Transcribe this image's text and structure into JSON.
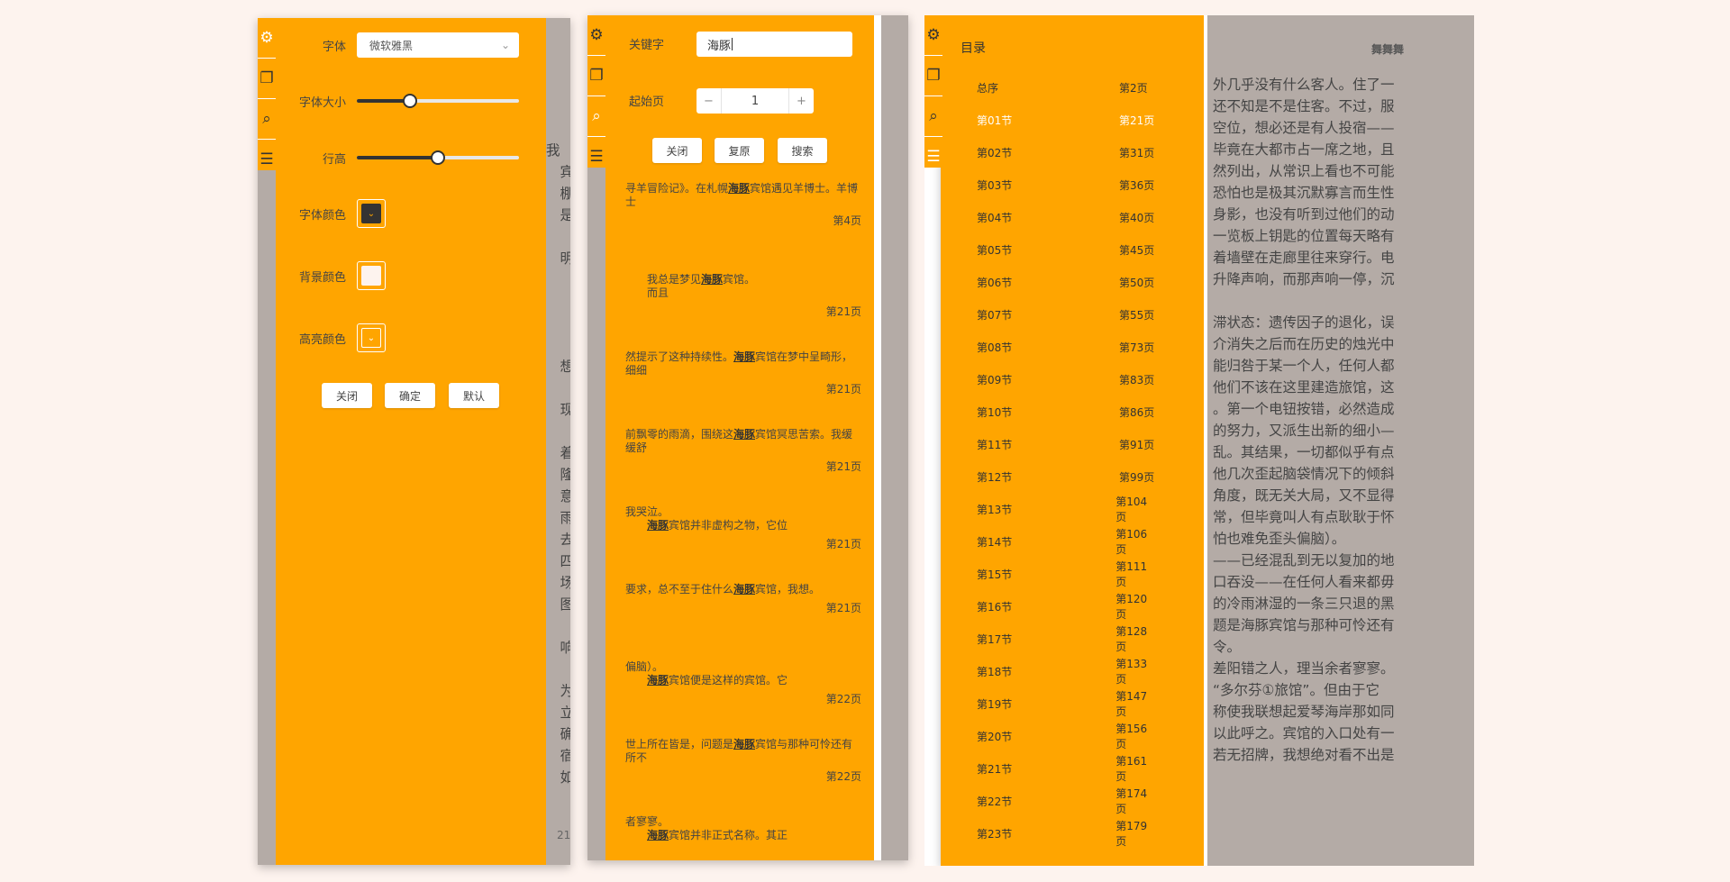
{
  "settings": {
    "font_label": "字体",
    "font_value": "微软雅黑",
    "font_size_label": "字体大小",
    "font_size_value": 0.33,
    "line_height_label": "行高",
    "line_height_value": 0.5,
    "font_color_label": "字体颜色",
    "font_color": "#333333",
    "bg_color_label": "背景颜色",
    "bg_color": "#fdf3ee",
    "highlight_color_label": "高亮颜色",
    "highlight_color": "#ffa500",
    "close_label": "关闭",
    "ok_label": "确定",
    "default_label": "默认"
  },
  "reader1": {
    "lines": "我\n　宾\n　棚\n　是在\n\n　明显\n\n\n\n\n　想。\n　　无\n　现\n　　然\n　着\n　隆\n　意\n　雨\n　去\n　四肢\n　场\n　图\n　　缓\n　响\n　　我\n　为\n　立于\n　确\n　宿\n　如",
    "page_no": "21"
  },
  "search": {
    "keyword_label": "关键字",
    "keyword_value": "海豚",
    "start_page_label": "起始页",
    "start_page_value": "1",
    "minus": "−",
    "plus": "+",
    "close_label": "关闭",
    "reset_label": "复原",
    "search_label": "搜索",
    "results": [
      {
        "before": "寻羊冒险记》。在札幌",
        "kw": "海豚",
        "after": "宾馆遇见羊博士。羊博士",
        "page": "第4页"
      },
      {
        "before": "　　我总是梦见",
        "kw": "海豚",
        "after": "宾馆。\n　　而且",
        "page": "第21页"
      },
      {
        "before": "然提示了这种持续性。",
        "kw": "海豚",
        "after": "宾馆在梦中呈畸形，细细",
        "page": "第21页"
      },
      {
        "before": "前飘零的雨滴，围绕这",
        "kw": "海豚",
        "after": "宾馆冥思苦索。我缓缓舒",
        "page": "第21页"
      },
      {
        "before": "我哭泣。\n　　",
        "kw": "海豚",
        "after": "宾馆并非虚构之物，它位",
        "page": "第21页"
      },
      {
        "before": "要求，总不至于住什么",
        "kw": "海豚",
        "after": "宾馆，我想。",
        "page": "第21页"
      },
      {
        "before": "偏脑）。\n　　",
        "kw": "海豚",
        "after": "宾馆便是这样的宾馆。它",
        "page": "第22页"
      },
      {
        "before": "世上所在皆是，问题是",
        "kw": "海豚",
        "after": "宾馆与那种可怜还有所不",
        "page": "第22页"
      },
      {
        "before": "者寥寥。\n　　",
        "kw": "海豚",
        "after": "宾馆并非正式名称。其正",
        "page": ""
      }
    ]
  },
  "toc": {
    "title": "目录",
    "items": [
      {
        "name": "总序",
        "page": "第2页"
      },
      {
        "name": "第01节",
        "page": "第21页"
      },
      {
        "name": "第02节",
        "page": "第31页"
      },
      {
        "name": "第03节",
        "page": "第36页"
      },
      {
        "name": "第04节",
        "page": "第40页"
      },
      {
        "name": "第05节",
        "page": "第45页"
      },
      {
        "name": "第06节",
        "page": "第50页"
      },
      {
        "name": "第07节",
        "page": "第55页"
      },
      {
        "name": "第08节",
        "page": "第73页"
      },
      {
        "name": "第09节",
        "page": "第83页"
      },
      {
        "name": "第10节",
        "page": "第86页"
      },
      {
        "name": "第11节",
        "page": "第91页"
      },
      {
        "name": "第12节",
        "page": "第99页"
      },
      {
        "name": "第13节",
        "page": "第104页"
      },
      {
        "name": "第14节",
        "page": "第106页"
      },
      {
        "name": "第15节",
        "page": "第111页"
      },
      {
        "name": "第16节",
        "page": "第120页"
      },
      {
        "name": "第17节",
        "page": "第128页"
      },
      {
        "name": "第18节",
        "page": "第133页"
      },
      {
        "name": "第19节",
        "page": "第147页"
      },
      {
        "name": "第20节",
        "page": "第156页"
      },
      {
        "name": "第21节",
        "page": "第161页"
      },
      {
        "name": "第22节",
        "page": "第174页"
      },
      {
        "name": "第23节",
        "page": "第179页"
      }
    ],
    "active_index": 1
  },
  "reader3": {
    "header": "舞舞舞",
    "lines": "外几乎没有什么客人。住了一\n还不知是不是住客。不过，服\n空位，想必还是有人投宿——\n毕竟在大都市占一席之地，且\n然列出，从常识上看也不可能\n恐怕也是极其沉默寡言而生性\n身影，也没有听到过他们的动\n一览板上钥匙的位置每天略有\n着墙壁在走廊里往来穿行。电\n升降声响，而那声响一停，沉\n\n滞状态：遗传因子的退化，误\n介消失之后而在历史的烛光中\n能归咎于某一个人，任何人都\n他们不该在这里建造旅馆，这\n。第一个电钮按错，必然造成\n的努力，又派生出新的细小—\n乱。其结果，一切都似乎有点\n他几次歪起脑袋情况下的倾斜\n角度，既无关大局，又不显得\n常，但毕竟叫人有点耿耿于怀\n怕也难免歪头偏脑）。\n——已经混乱到无以复加的地\n口吞没——在任何人看来都毋\n的冷雨淋湿的一条三只退的黑\n题是海豚宾馆与那种可怜还有\n令。\n差阳错之人，理当余者寥寥。\n“多尔芬①旅馆”。但由于它\n称使我联想起爱琴海岸那如同\n以此呼之。宾馆的入口处有一\n若无招牌，我想绝对看不出是"
  },
  "icons": [
    "gear-icon",
    "copy-icon",
    "search-icon",
    "list-icon"
  ]
}
